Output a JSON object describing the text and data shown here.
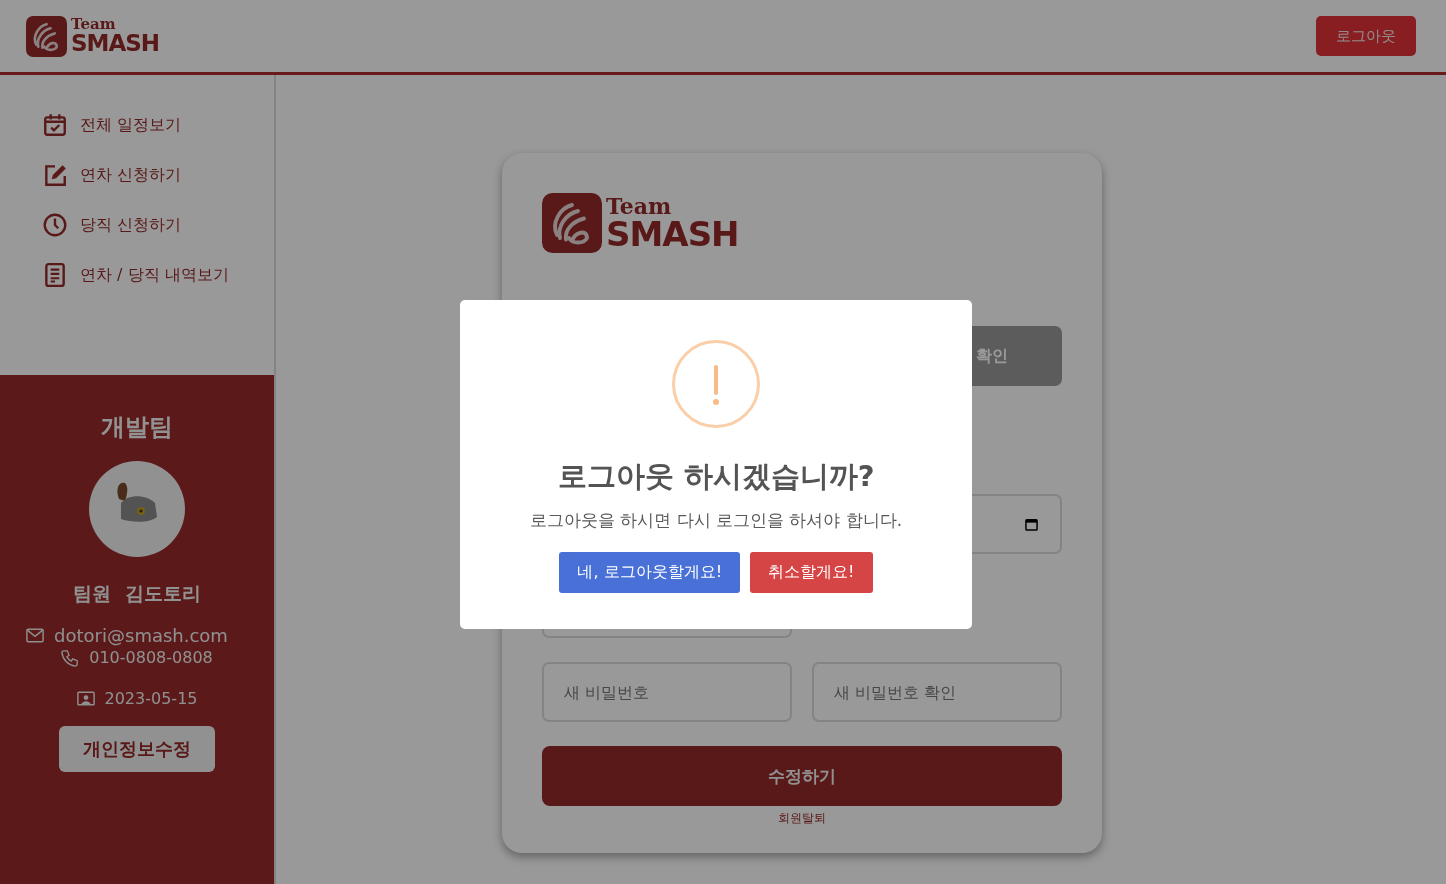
{
  "header": {
    "logo": {
      "line1": "Team",
      "line2": "SMASH"
    },
    "logout_button": "로그아웃"
  },
  "sidebar": {
    "nav": [
      {
        "kind": "calendar",
        "label": "전체 일정보기"
      },
      {
        "kind": "edit",
        "label": "연차 신청하기"
      },
      {
        "kind": "clock",
        "label": "당직 신청하기"
      },
      {
        "kind": "list",
        "label": "연차 / 당직 내역보기"
      }
    ],
    "profile": {
      "team": "개발팀",
      "name": "팀원  김도토리",
      "email": "dotori@smash.com",
      "phone": "010-0808-0808",
      "joined": "2023-05-15",
      "edit_button": "개인정보수정"
    }
  },
  "card": {
    "logo": {
      "line1": "Team",
      "line2": "SMASH"
    },
    "form_rows": [
      [
        {
          "kind": "blank"
        },
        {
          "kind": "button",
          "label": "확인"
        }
      ],
      [
        {
          "kind": "blank"
        },
        {
          "kind": "date"
        }
      ],
      [
        {
          "kind": "input"
        },
        {
          "kind": "blank"
        }
      ],
      [
        {
          "kind": "input",
          "placeholder": "새 비밀번호"
        },
        {
          "kind": "input",
          "placeholder": "새 비밀번호 확인"
        }
      ]
    ],
    "submit_button": "수정하기",
    "withdraw_link": "회원탈퇴"
  },
  "modal": {
    "title": "로그아웃 하시겠습니까?",
    "message": "로그아웃을 하시면 다시 로그인을 하셔야 합니다.",
    "confirm_button": "네, 로그아웃할게요!",
    "cancel_button": "취소할게요!"
  }
}
